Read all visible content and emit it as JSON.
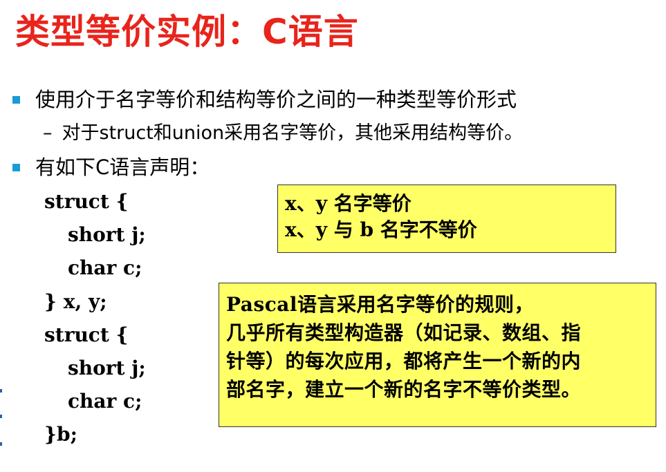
{
  "slide": {
    "title": "类型等价实例：C语言",
    "bullets": [
      "使用介于名字等价和结构等价之间的一种类型等价形式",
      "有如下C语言声明："
    ],
    "sub_bullet": {
      "dash": "–",
      "text": "对于struct和union采用名字等价，其他采用结构等价。"
    },
    "code_lines": [
      "struct {",
      "short j;",
      "char c;",
      "} x, y;",
      "struct {",
      "short j;",
      "char c;",
      "}b;"
    ],
    "note_box_1": [
      "x、y 名字等价",
      "x、y 与 b 名字不等价"
    ],
    "note_box_2": [
      "Pascal语言采用名字等价的规则，",
      "几乎所有类型构造器（如记录、数组、指",
      "针等）的每次应用，都将产生一个新的内",
      "部名字，建立一个新的名字不等价类型。"
    ]
  },
  "colors": {
    "title": "#e8241c",
    "bullet": "#1a9bd7",
    "note_background": "#ffff66"
  }
}
